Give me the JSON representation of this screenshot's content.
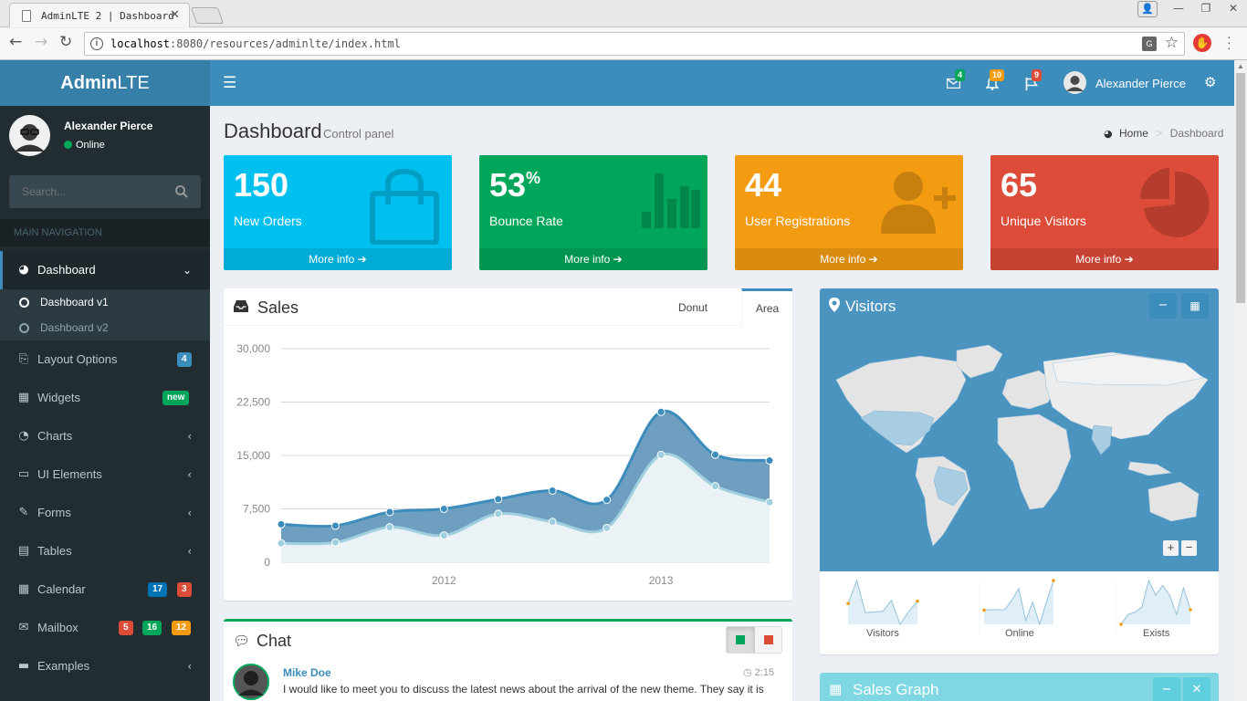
{
  "browser": {
    "tab_title": "AdminLTE 2 | Dashboard",
    "url_host": "localhost",
    "url_rest": ":8080/resources/adminlte/index.html"
  },
  "header": {
    "logo_bold": "Admin",
    "logo_rest": "LTE",
    "messages_count": "4",
    "notifications_count": "10",
    "tasks_count": "9",
    "user_name": "Alexander Pierce"
  },
  "sidebar": {
    "user_name": "Alexander Pierce",
    "status": "Online",
    "search_placeholder": "Search...",
    "section_title": "MAIN NAVIGATION",
    "items": [
      {
        "label": "Dashboard"
      },
      {
        "label": "Layout Options",
        "badges": [
          "4"
        ]
      },
      {
        "label": "Widgets",
        "badges": [
          "new"
        ]
      },
      {
        "label": "Charts"
      },
      {
        "label": "UI Elements"
      },
      {
        "label": "Forms"
      },
      {
        "label": "Tables"
      },
      {
        "label": "Calendar",
        "badges": [
          "17",
          "3"
        ]
      },
      {
        "label": "Mailbox",
        "badges": [
          "5",
          "16",
          "12"
        ]
      },
      {
        "label": "Examples"
      }
    ],
    "subitems": [
      {
        "label": "Dashboard v1"
      },
      {
        "label": "Dashboard v2"
      }
    ]
  },
  "page": {
    "title": "Dashboard",
    "subtitle": "Control panel",
    "breadcrumb_home": "Home",
    "breadcrumb_current": "Dashboard"
  },
  "stats": [
    {
      "value": "150",
      "label": "New Orders",
      "more": "More info",
      "color": "#00c0ef",
      "icon": "shopping-bag-icon"
    },
    {
      "value": "53",
      "suffix": "%",
      "label": "Bounce Rate",
      "more": "More info",
      "color": "#00a65a",
      "icon": "bar-chart-icon"
    },
    {
      "value": "44",
      "label": "User Registrations",
      "more": "More info",
      "color": "#f39c12",
      "icon": "person-add-icon"
    },
    {
      "value": "65",
      "label": "Unique Visitors",
      "more": "More info",
      "color": "#dd4b39",
      "icon": "pie-chart-icon"
    }
  ],
  "sales": {
    "title": "Sales",
    "tabs": [
      "Donut",
      "Area"
    ]
  },
  "chart_data": {
    "type": "area",
    "x": [
      2011.25,
      2011.5,
      2011.75,
      2012.0,
      2012.25,
      2012.5,
      2012.75,
      2013.0,
      2013.25,
      2013.5
    ],
    "x_tick_labels": [
      "2012",
      "2013"
    ],
    "x_ticks": [
      2012.0,
      2013.0
    ],
    "series": [
      {
        "values": [
          2666,
          2778,
          4912,
          3767,
          6810,
          5670,
          4820,
          15073,
          10687,
          8432
        ],
        "color": "#a0d0e0"
      },
      {
        "values": [
          5332,
          5136,
          7057,
          7506,
          8864,
          10068,
          8770,
          21122,
          15107,
          14288
        ],
        "color": "#3c8dbc"
      }
    ],
    "y_ticks": [
      "30,000",
      "22,500",
      "15,000",
      "7,500",
      "0"
    ],
    "ylim": [
      0,
      30000
    ],
    "stacked": false,
    "grid": true
  },
  "chat": {
    "title": "Chat",
    "message_author": "Mike Doe",
    "message_time": "2:15",
    "message_text": "I would like to meet you to discuss the latest news about the arrival of the new theme. They say it is"
  },
  "visitors": {
    "title": "Visitors",
    "sparklines": [
      {
        "label": "Visitors",
        "values": [
          1000,
          1200,
          920,
          927,
          931,
          1027,
          819,
          930,
          1021
        ]
      },
      {
        "label": "Online",
        "values": [
          515,
          519,
          520,
          522,
          652,
          810,
          370,
          627,
          319,
          630,
          921
        ]
      },
      {
        "label": "Exists",
        "values": [
          15,
          19,
          20,
          22,
          33,
          27,
          31,
          27,
          19,
          30,
          21
        ]
      }
    ]
  },
  "sales_graph": {
    "title": "Sales Graph"
  }
}
